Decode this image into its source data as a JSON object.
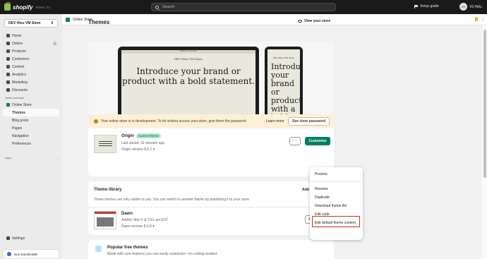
{
  "topbar": {
    "brand": "shopify",
    "edition": "Winter '23",
    "search_placeholder": "Search",
    "setup_label": "Setup guide",
    "user_initials": "VH",
    "user_name": "Vũ Hiếu"
  },
  "sidebar": {
    "store_name": "DEV Hieu VM Store",
    "items": [
      {
        "label": "Home",
        "icon": "home-icon"
      },
      {
        "label": "Orders",
        "icon": "orders-icon",
        "badge": "1"
      },
      {
        "label": "Products",
        "icon": "tag-icon"
      },
      {
        "label": "Customers",
        "icon": "person-icon"
      },
      {
        "label": "Content",
        "icon": "content-icon"
      },
      {
        "label": "Analytics",
        "icon": "chart-icon"
      },
      {
        "label": "Marketing",
        "icon": "target-icon"
      },
      {
        "label": "Discounts",
        "icon": "discount-icon"
      }
    ],
    "sales_channels_label": "Sales channels",
    "online_store_label": "Online Store",
    "sub_items": [
      "Themes",
      "Blog posts",
      "Pages",
      "Navigation",
      "Preferences"
    ],
    "apps_label": "Apps",
    "settings_label": "Settings",
    "nontransferable_label": "Non-transferable"
  },
  "header": {
    "breadcrumb": "Online Store"
  },
  "page": {
    "title": "Themes",
    "view_store": "View your store"
  },
  "preview": {
    "announcement": "Welcome to our store",
    "store_name": "DEV Hieu VM Store",
    "hero_text": "Introduce your brand or product with a bold statement.",
    "phone_store_name": "DEV Hieu VM Store",
    "phone_hero_text": "Introduce your brand or product with a bold"
  },
  "banner": {
    "text": "Your online store is in development. To let visitors access your store, give them the password.",
    "learn_more": "Learn more",
    "button": "See store password"
  },
  "current_theme": {
    "name": "Origin",
    "badge": "Current theme",
    "last_saved": "Last saved: 32 minutes ago",
    "version": "Origin version 8.0.1",
    "more_label": "···",
    "customize": "Customize"
  },
  "library": {
    "title": "Theme library",
    "description": "These themes are only visible to you. You can switch to another theme by publishing it to your store.",
    "add_theme": "Add theme",
    "theme": {
      "name": "Dawn",
      "added": "Added: Mar 6 at 2:51 am EST",
      "version": "Dawn version 8.0.0",
      "customize": "Customize"
    }
  },
  "popular": {
    "title": "Popular free themes",
    "description": "Made with core features you can easily customize—no coding needed."
  },
  "menu": {
    "items": [
      "Preview",
      "Rename",
      "Duplicate",
      "Download theme file",
      "Edit code",
      "Edit default theme content"
    ]
  }
}
